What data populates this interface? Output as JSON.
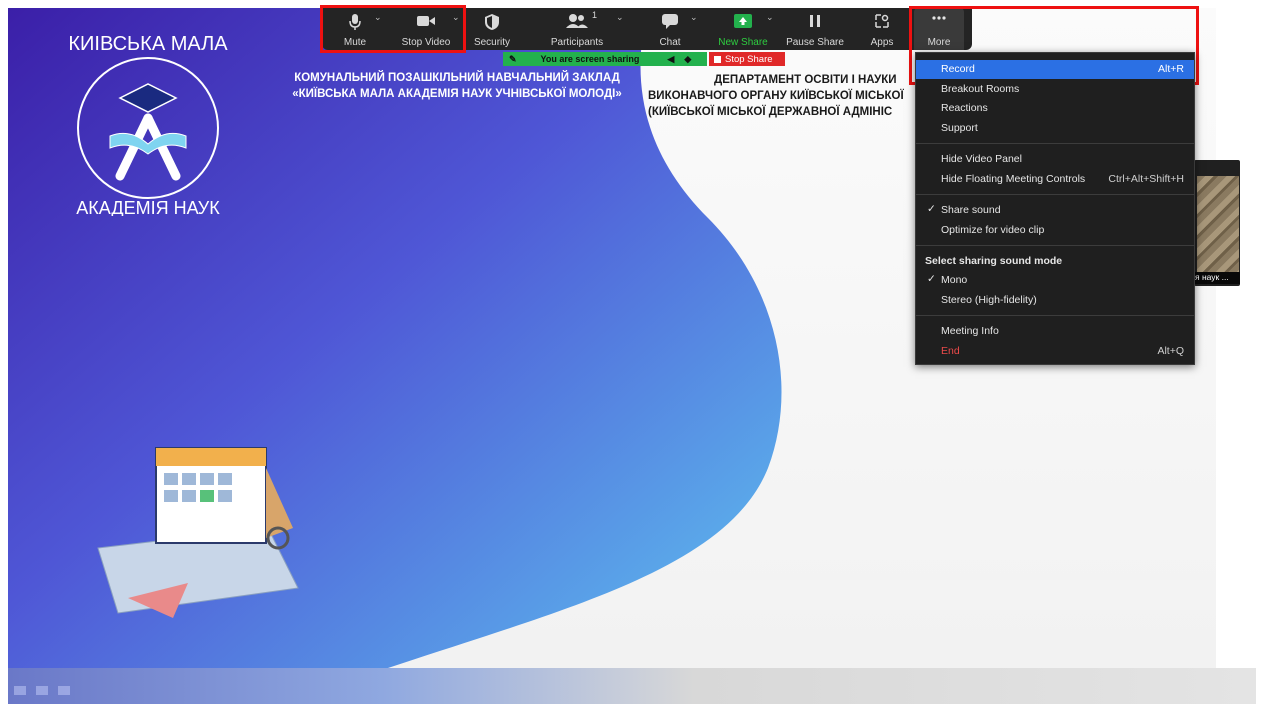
{
  "toolbar": {
    "buttons": [
      {
        "label": "Mute",
        "icon": "microphone-icon"
      },
      {
        "label": "Stop Video",
        "icon": "video-camera-icon"
      },
      {
        "label": "Security",
        "icon": "shield-icon"
      },
      {
        "label": "Participants",
        "icon": "participants-icon",
        "count": "1"
      },
      {
        "label": "Chat",
        "icon": "chat-bubble-icon"
      },
      {
        "label": "New Share",
        "icon": "share-screen-icon"
      },
      {
        "label": "Pause Share",
        "icon": "pause-icon"
      },
      {
        "label": "Apps",
        "icon": "apps-icon"
      },
      {
        "label": "More",
        "icon": "more-dots-icon"
      }
    ]
  },
  "sharing": {
    "status": "You are screen sharing",
    "stop_label": "Stop Share"
  },
  "slide": {
    "header_left_1": "КОМУНАЛЬНИЙ ПОЗАШКІЛЬНИЙ НАВЧАЛЬНИЙ ЗАКЛАД",
    "header_left_2": "«КИЇВСЬКА МАЛА АКАДЕМІЯ НАУК УЧНІВСЬКОЇ МОЛОДІ»",
    "header_right_1": "ДЕПАРТАМЕНТ ОСВІТИ І НАУКИ",
    "header_right_2": "ВИКОНАВЧОГО ОРГАНУ КИЇВСЬКОЇ МІСЬКОЇ",
    "header_right_3": "(КИЇВСЬКОЇ МІСЬКОЇ ДЕРЖАВНОЇ АДМІНІС",
    "logo_text": "КИЇВСЬКА МАЛА АКАДЕМІЯ НАУК"
  },
  "more_menu": {
    "record": {
      "label": "Record",
      "shortcut": "Alt+R"
    },
    "breakout": "Breakout Rooms",
    "reactions": "Reactions",
    "support": "Support",
    "hide_video": "Hide Video Panel",
    "hide_floating": {
      "label": "Hide Floating Meeting Controls",
      "shortcut": "Ctrl+Alt+Shift+H"
    },
    "share_sound": "Share sound",
    "optimize": "Optimize for video clip",
    "sound_mode_header": "Select sharing sound mode",
    "mono": "Mono",
    "stereo": "Stereo (High-fidelity)",
    "meeting_info": "Meeting Info",
    "end": {
      "label": "End",
      "shortcut": "Alt+Q"
    },
    "checkmark": "✓"
  },
  "video_panel": {
    "caption": "я наук ..."
  },
  "colors": {
    "accent_blue": "#2b70e4",
    "share_green": "#23b14d",
    "stop_red": "#e02828",
    "highlight_red": "#ee1111",
    "slide_purple": "#3b1fa8",
    "slide_blue": "#5ec3f0"
  }
}
